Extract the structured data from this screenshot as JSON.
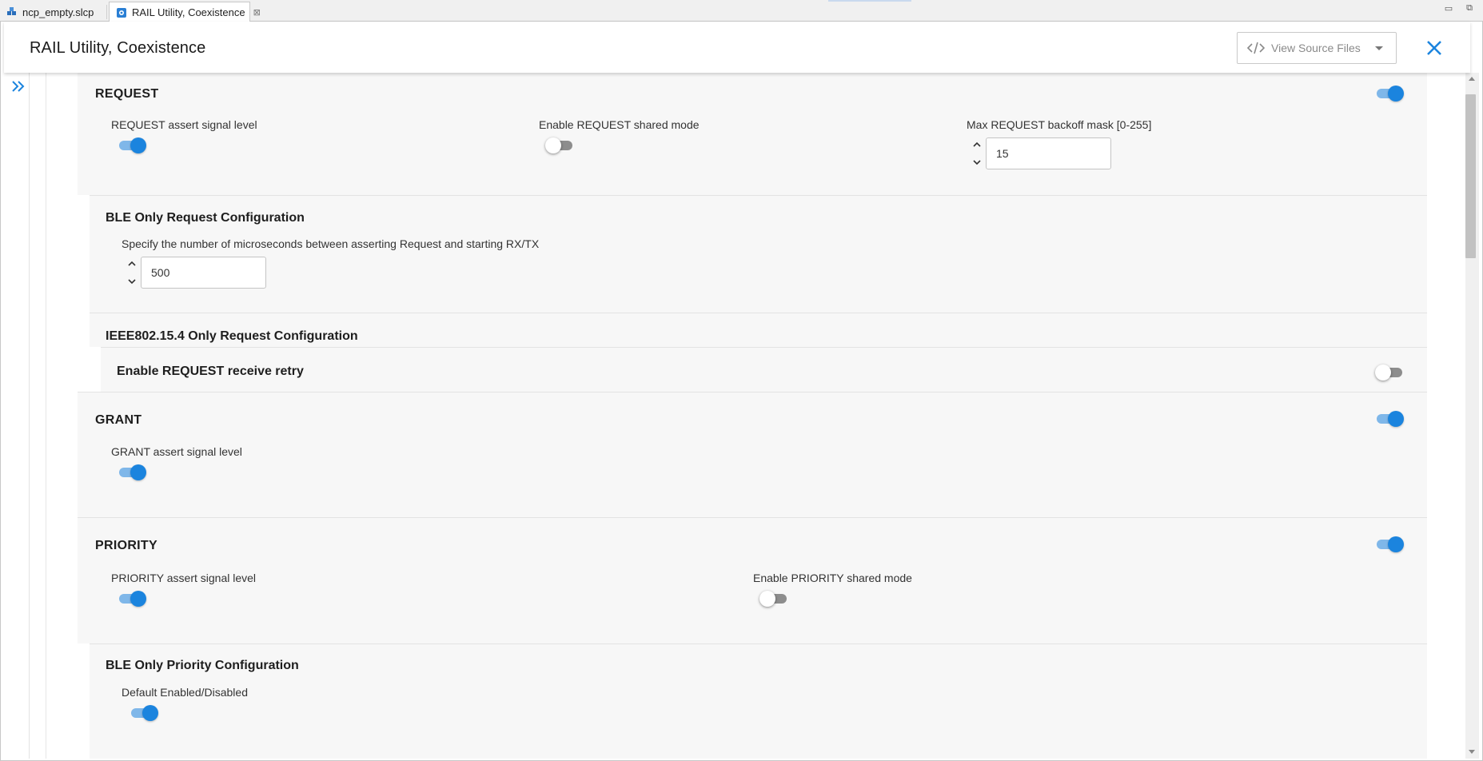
{
  "tabs": [
    {
      "label": "ncp_empty.slcp",
      "active": false
    },
    {
      "label": "RAIL Utility, Coexistence",
      "active": true,
      "close_glyph": "⊠"
    }
  ],
  "window_controls": {
    "minimize": "▭",
    "restore": "⧉"
  },
  "header": {
    "title": "RAIL Utility, Coexistence",
    "view_source_label": "View Source Files"
  },
  "request": {
    "title": "REQUEST",
    "enabled": true,
    "assert_label": "REQUEST assert signal level",
    "assert_on": true,
    "shared_label": "Enable REQUEST shared mode",
    "shared_on": false,
    "backoff_label": "Max REQUEST backoff mask [0-255]",
    "backoff_value": "15"
  },
  "ble_request": {
    "title": "BLE Only Request Configuration",
    "delay_label": "Specify the number of microseconds between asserting Request and starting RX/TX",
    "delay_value": "500"
  },
  "ieee_request": {
    "title": "IEEE802.15.4 Only Request Configuration",
    "retry_label": "Enable REQUEST receive retry",
    "retry_on": false
  },
  "grant": {
    "title": "GRANT",
    "enabled": true,
    "assert_label": "GRANT assert signal level",
    "assert_on": true
  },
  "priority": {
    "title": "PRIORITY",
    "enabled": true,
    "assert_label": "PRIORITY assert signal level",
    "assert_on": true,
    "shared_label": "Enable PRIORITY shared mode",
    "shared_on": false
  },
  "ble_priority": {
    "title": "BLE Only Priority Configuration",
    "default_label": "Default Enabled/Disabled",
    "default_on": true
  },
  "colors": {
    "accent": "#1b84de",
    "toggle_track_on": "#7fb7e9",
    "toggle_track_off": "#8d8d8d",
    "section_bg": "#f7f7f7"
  }
}
